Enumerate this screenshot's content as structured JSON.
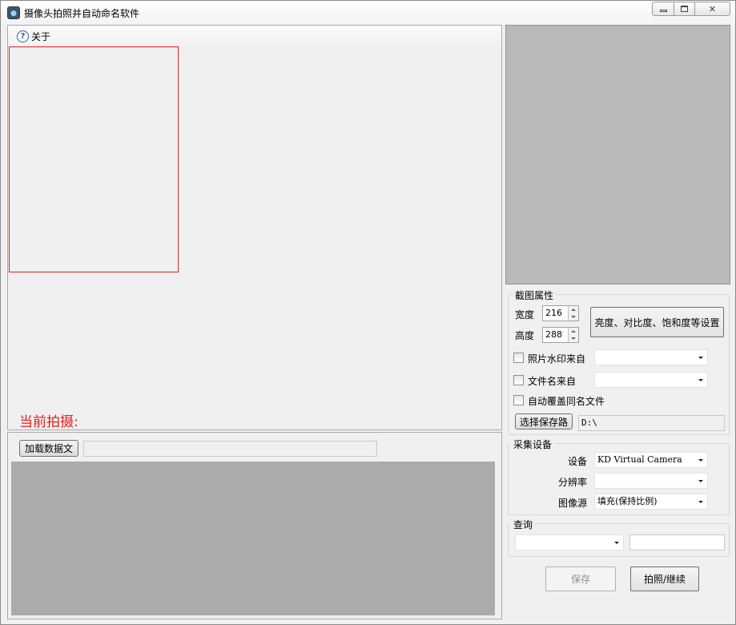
{
  "window": {
    "title": "摄像头拍照并自动命名软件",
    "min_glyph": "",
    "max_glyph": "",
    "close_glyph": "✕"
  },
  "menu": {
    "about_label": "关于",
    "help_icon_glyph": "?"
  },
  "capture": {
    "current_label": "当前拍摄:"
  },
  "data_panel": {
    "load_button": "加载数据文",
    "load_path_value": ""
  },
  "crop": {
    "group_title": "截图属性",
    "width_label": "宽度",
    "width_value": "216",
    "height_label": "高度",
    "height_value": "288",
    "adjust_button": "亮度、对比度、饱和度等设置",
    "watermark_label": "照片水印来自",
    "watermark_value": "",
    "filename_label": "文件名来自",
    "filename_value": "",
    "overwrite_label": "自动覆盖同名文件",
    "select_path_button": "选择保存路",
    "save_path": "D:\\"
  },
  "device": {
    "group_title": "采集设备",
    "device_label": "设备",
    "device_value": "KD Virtual Camera",
    "resolution_label": "分辨率",
    "resolution_value": "",
    "source_label": "图像源",
    "source_value": "填充(保持比例)"
  },
  "query": {
    "group_title": "查询",
    "field_value": "",
    "text_value": ""
  },
  "actions": {
    "save_button": "保存",
    "capture_button": "拍照/继续"
  },
  "colors": {
    "red_accent": "#e02020",
    "preview_gray": "#b9b9b9",
    "grid_gray": "#ababab"
  }
}
